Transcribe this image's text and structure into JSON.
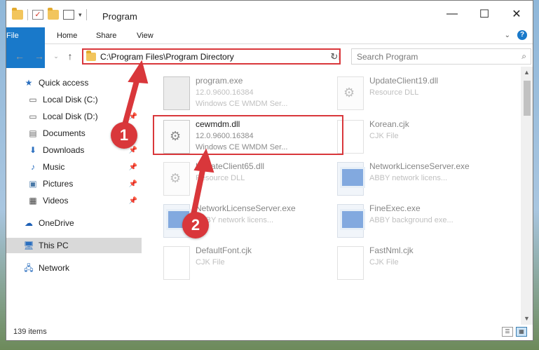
{
  "window": {
    "title": "Program",
    "controls": [
      "—",
      "☐",
      "✕"
    ]
  },
  "ribbon": {
    "tabs": [
      "File",
      "Home",
      "Share",
      "View"
    ],
    "help": "?"
  },
  "address": {
    "path": "C:\\Program Files\\Program Directory",
    "search_placeholder": "Search Program"
  },
  "sidebar": {
    "items": [
      {
        "label": "Quick access",
        "icon": "star-icon",
        "pinned": false
      },
      {
        "label": "Local Disk (C:)",
        "icon": "drive-icon",
        "pinned": false
      },
      {
        "label": "Local Disk (D:)",
        "icon": "drive-icon",
        "pinned": true
      },
      {
        "label": "Documents",
        "icon": "documents-icon",
        "pinned": true
      },
      {
        "label": "Downloads",
        "icon": "download-icon",
        "pinned": true
      },
      {
        "label": "Music",
        "icon": "music-icon",
        "pinned": true
      },
      {
        "label": "Pictures",
        "icon": "pictures-icon",
        "pinned": true
      },
      {
        "label": "Videos",
        "icon": "videos-icon",
        "pinned": true
      },
      {
        "label": "OneDrive",
        "icon": "cloud-icon",
        "pinned": false
      },
      {
        "label": "This PC",
        "icon": "computer-icon",
        "pinned": false,
        "selected": true
      },
      {
        "label": "Network",
        "icon": "network-icon",
        "pinned": false
      }
    ]
  },
  "files": [
    {
      "name": "program.exe",
      "line2": "12.0.9600.16384",
      "line3": "Windows CE WMDM Ser...",
      "type": "prog"
    },
    {
      "name": "UpdateClient19.dll",
      "line2": "Resource DLL",
      "line3": "",
      "type": "dll"
    },
    {
      "name": "cewmdm.dll",
      "line2": "12.0.9600.16384",
      "line3": "Windows CE WMDM Ser...",
      "type": "dll"
    },
    {
      "name": "Korean.cjk",
      "line2": "CJK File",
      "line3": "",
      "type": "doc"
    },
    {
      "name": "UpdateClient65.dll",
      "line2": "Resource DLL",
      "line3": "",
      "type": "dll"
    },
    {
      "name": "NetworkLicenseServer.exe",
      "line2": "ABBY network licens...",
      "line3": "",
      "type": "exe"
    },
    {
      "name": "NetworkLicenseServer.exe",
      "line2": "ABBY network licens...",
      "line3": "",
      "type": "exe"
    },
    {
      "name": "FineExec.exe",
      "line2": "ABBY background exe...",
      "line3": "",
      "type": "exe"
    },
    {
      "name": "DefaultFont.cjk",
      "line2": "CJK File",
      "line3": "",
      "type": "doc"
    },
    {
      "name": "FastNml.cjk",
      "line2": "CJK File",
      "line3": "",
      "type": "doc"
    }
  ],
  "status": {
    "item_count": "139 items"
  },
  "annotations": {
    "badge1": "1",
    "badge2": "2",
    "color": "#d9373b"
  }
}
